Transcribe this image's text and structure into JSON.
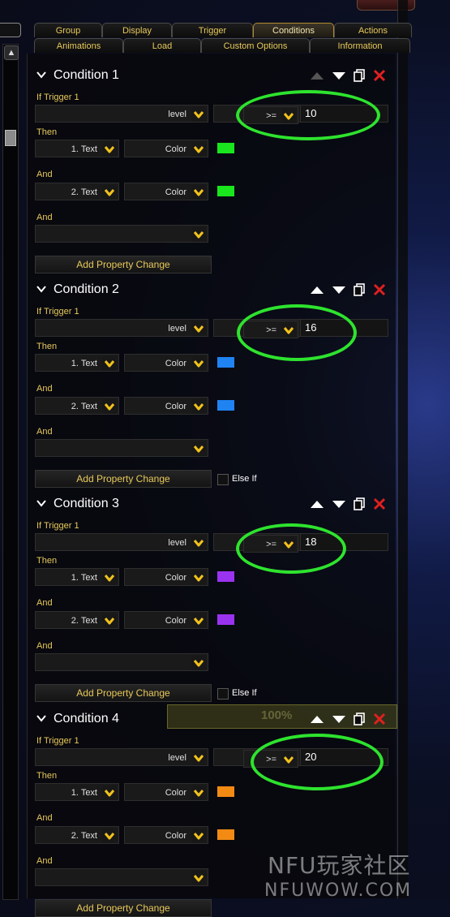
{
  "tabs_row1": [
    "Group",
    "Display",
    "Trigger",
    "Conditions",
    "Actions"
  ],
  "tabs_row2": [
    "Animations",
    "Load",
    "Custom Options",
    "Information"
  ],
  "active_tab": "Conditions",
  "labels": {
    "if_trigger": "If Trigger 1",
    "then": "Then",
    "and": "And",
    "add_property_change": "Add Property Change",
    "else_if": "Else If"
  },
  "conditions": [
    {
      "title": "Condition 1",
      "property": "level",
      "operator": ">=",
      "value": "10",
      "changes": [
        {
          "slot": "1. Text",
          "prop": "Color",
          "color": "#19e61c"
        },
        {
          "slot": "2. Text",
          "prop": "Color",
          "color": "#19e61c"
        }
      ]
    },
    {
      "title": "Condition 2",
      "property": "level",
      "operator": ">=",
      "value": "16",
      "changes": [
        {
          "slot": "1. Text",
          "prop": "Color",
          "color": "#1f83f2"
        },
        {
          "slot": "2. Text",
          "prop": "Color",
          "color": "#1f83f2"
        }
      ]
    },
    {
      "title": "Condition 3",
      "property": "level",
      "operator": ">=",
      "value": "18",
      "changes": [
        {
          "slot": "1. Text",
          "prop": "Color",
          "color": "#9a33f0"
        },
        {
          "slot": "2. Text",
          "prop": "Color",
          "color": "#9a33f0"
        }
      ]
    },
    {
      "title": "Condition 4",
      "property": "level",
      "operator": ">=",
      "value": "20",
      "changes": [
        {
          "slot": "1. Text",
          "prop": "Color",
          "color": "#f28a13"
        },
        {
          "slot": "2. Text",
          "prop": "Color",
          "color": "#f28a13"
        }
      ]
    }
  ],
  "ghost_progress": "100%",
  "watermark": {
    "line1": "NFU玩家社区",
    "line2": "NFUWOW.COM"
  },
  "colors": {
    "accent": "#e8c95a",
    "annotation": "#2ee32e",
    "delete": "#e02020"
  }
}
